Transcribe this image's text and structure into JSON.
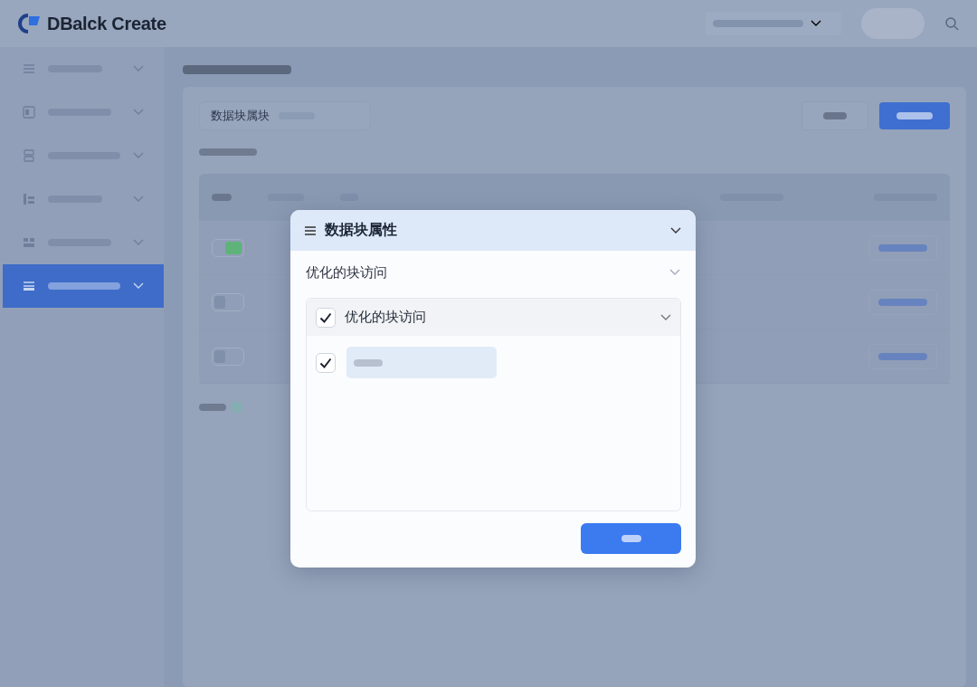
{
  "app": {
    "title": "DBalck Create"
  },
  "sidebar": {
    "items": [
      {
        "selected": false
      },
      {
        "selected": false
      },
      {
        "selected": false
      },
      {
        "selected": false
      },
      {
        "selected": false
      },
      {
        "selected": true
      }
    ]
  },
  "toolbar": {
    "label": "数据块属块"
  },
  "table": {
    "rows": [
      {
        "toggle_on": true
      },
      {
        "toggle_on": false
      },
      {
        "toggle_on": false
      }
    ]
  },
  "dialog": {
    "title": "数据块属性",
    "section": "优化的块访问",
    "group": {
      "label": "优化的块访问",
      "checked": true,
      "options": [
        {
          "checked": true
        }
      ]
    }
  }
}
